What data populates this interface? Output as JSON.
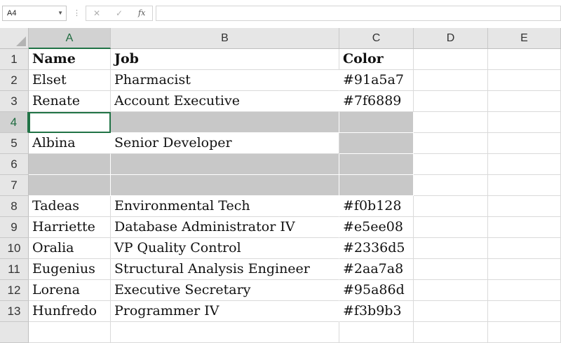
{
  "formula_bar": {
    "name_box": "A4",
    "cancel_icon": "✕",
    "enter_icon": "✓",
    "fx_label": "fx",
    "formula": ""
  },
  "columns": [
    "A",
    "B",
    "C",
    "D",
    "E"
  ],
  "rows": [
    {
      "num": "1",
      "a": "Name",
      "b": "Job",
      "c": "Color"
    },
    {
      "num": "2",
      "a": "Elset",
      "b": "Pharmacist",
      "c": "#91a5a7"
    },
    {
      "num": "3",
      "a": "Renate",
      "b": "Account Executive",
      "c": "#7f6889"
    },
    {
      "num": "4",
      "a": "",
      "b": "",
      "c": ""
    },
    {
      "num": "5",
      "a": "Albina",
      "b": "Senior Developer",
      "c": ""
    },
    {
      "num": "6",
      "a": "",
      "b": "",
      "c": ""
    },
    {
      "num": "7",
      "a": "",
      "b": "",
      "c": ""
    },
    {
      "num": "8",
      "a": "Tadeas",
      "b": "Environmental Tech",
      "c": "#f0b128"
    },
    {
      "num": "9",
      "a": "Harriette",
      "b": "Database Administrator IV",
      "c": "#e5ee08"
    },
    {
      "num": "10",
      "a": "Oralia",
      "b": "VP Quality Control",
      "c": "#2336d5"
    },
    {
      "num": "11",
      "a": "Eugenius",
      "b": "Structural Analysis Engineer",
      "c": "#2aa7a8"
    },
    {
      "num": "12",
      "a": "Lorena",
      "b": "Executive Secretary",
      "c": "#95a86d"
    },
    {
      "num": "13",
      "a": "Hunfredo",
      "b": "Programmer IV",
      "c": "#f3b9b3"
    }
  ],
  "colors": {
    "selection_accent": "#217346",
    "gray_fill": "#c8c8c8",
    "header_bg": "#e6e6e6"
  }
}
